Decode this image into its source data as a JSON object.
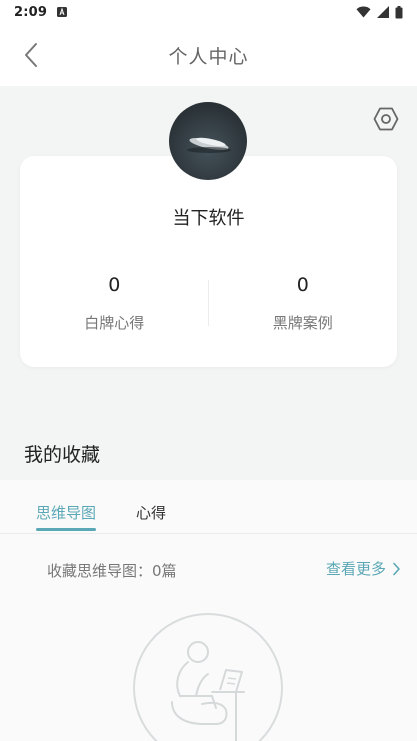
{
  "status_bar": {
    "time": "2:09",
    "icons": [
      "notification-a-icon",
      "wifi-icon",
      "signal-icon",
      "battery-icon"
    ]
  },
  "header": {
    "title": "个人中心",
    "back_icon": "chevron-left-icon"
  },
  "profile": {
    "settings_icon": "hexagon-settings-icon",
    "username": "当下软件",
    "stats": [
      {
        "value": "0",
        "label": "白牌心得"
      },
      {
        "value": "0",
        "label": "黑牌案例"
      }
    ]
  },
  "favorites": {
    "section_title": "我的收藏",
    "tabs": [
      {
        "label": "思维导图",
        "active": true
      },
      {
        "label": "心得",
        "active": false
      }
    ],
    "count_text": "收藏思维导图：0篇",
    "view_more": "查看更多"
  },
  "colors": {
    "accent": "#5aa7b5",
    "background": "#f3f4f4",
    "card": "#ffffff"
  }
}
